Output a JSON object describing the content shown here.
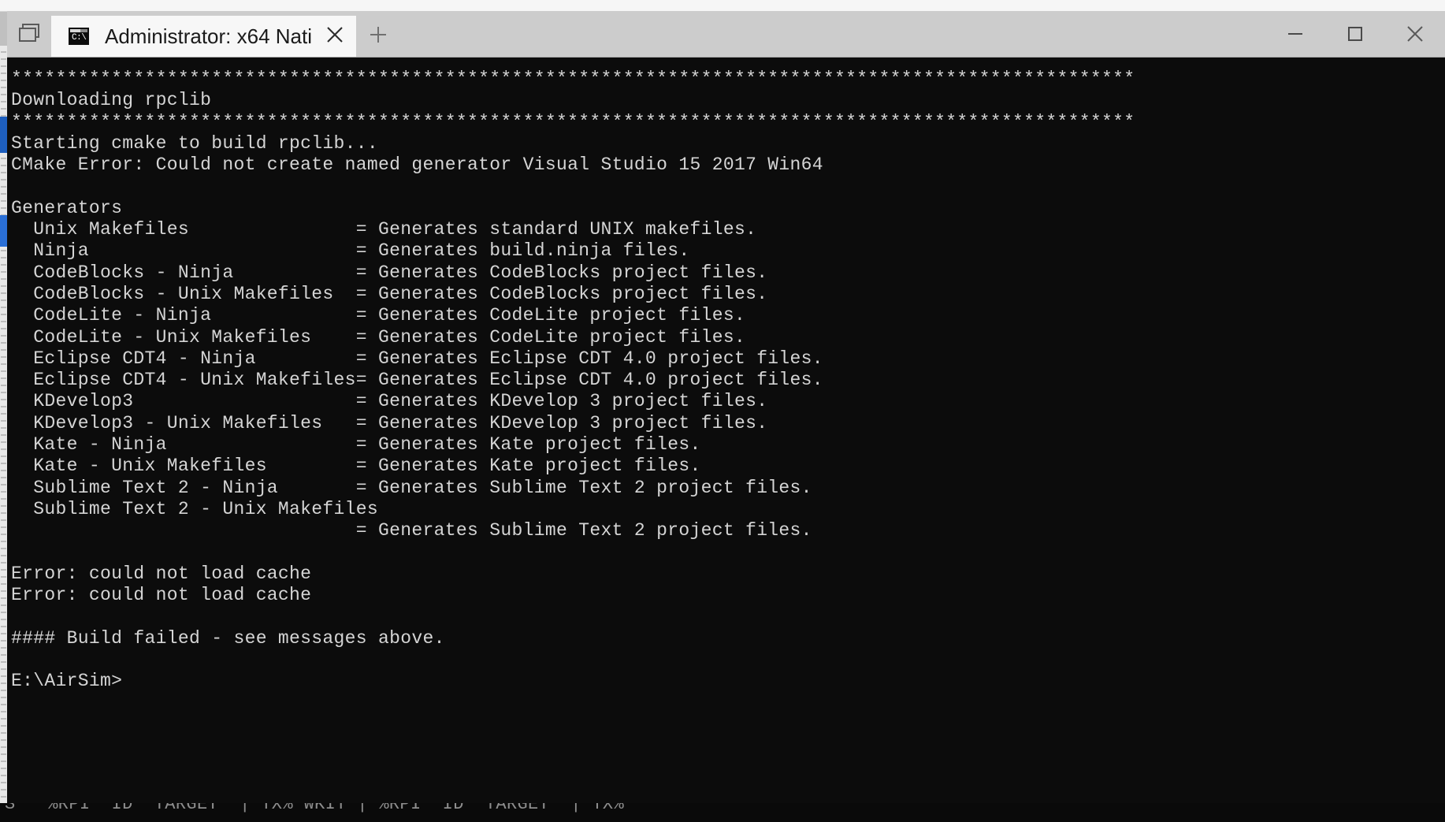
{
  "window": {
    "title": "Administrator: x64 Nati",
    "chrome_color": "#cccccc",
    "tab_active_color": "#f7f7f7",
    "console_bg": "#0c0c0c",
    "console_fg": "#d5d5d5"
  },
  "tabbar": {
    "tab_list_icon": "tab-list-icon",
    "tab": {
      "icon": "cmd-prompt-icon",
      "icon_text": "C:\\",
      "label": "Administrator: x64 Nati",
      "close_icon": "close-icon"
    },
    "new_tab_icon": "plus-icon",
    "new_tab_label": "+"
  },
  "window_controls": {
    "minimize": {
      "name": "minimize-button",
      "glyph": "—"
    },
    "maximize": {
      "name": "maximize-button",
      "glyph": "□"
    },
    "close": {
      "name": "close-button",
      "glyph": "✕"
    }
  },
  "console": {
    "lines": [
      "*****************************************************************************************************",
      "Downloading rpclib",
      "*****************************************************************************************************",
      "Starting cmake to build rpclib...",
      "CMake Error: Could not create named generator Visual Studio 15 2017 Win64",
      "",
      "Generators",
      "  Unix Makefiles               = Generates standard UNIX makefiles.",
      "  Ninja                        = Generates build.ninja files.",
      "  CodeBlocks - Ninja           = Generates CodeBlocks project files.",
      "  CodeBlocks - Unix Makefiles  = Generates CodeBlocks project files.",
      "  CodeLite - Ninja             = Generates CodeLite project files.",
      "  CodeLite - Unix Makefiles    = Generates CodeLite project files.",
      "  Eclipse CDT4 - Ninja         = Generates Eclipse CDT 4.0 project files.",
      "  Eclipse CDT4 - Unix Makefiles= Generates Eclipse CDT 4.0 project files.",
      "  KDevelop3                    = Generates KDevelop 3 project files.",
      "  KDevelop3 - Unix Makefiles   = Generates KDevelop 3 project files.",
      "  Kate - Ninja                 = Generates Kate project files.",
      "  Kate - Unix Makefiles        = Generates Kate project files.",
      "  Sublime Text 2 - Ninja       = Generates Sublime Text 2 project files.",
      "  Sublime Text 2 - Unix Makefiles",
      "                               = Generates Sublime Text 2 project files.",
      "",
      "Error: could not load cache",
      "Error: could not load cache",
      "",
      "#### Build failed - see messages above.",
      "",
      "E:\\AirSim>"
    ],
    "prompt": "E:\\AirSim>"
  },
  "background": {
    "top_ghost": ",  .        ,        .           ,          .",
    "bottom_ghost": "S   %RPI  ID  TARGET  | TX% WKIT | %RPI  ID  TARGET  | TX%"
  }
}
